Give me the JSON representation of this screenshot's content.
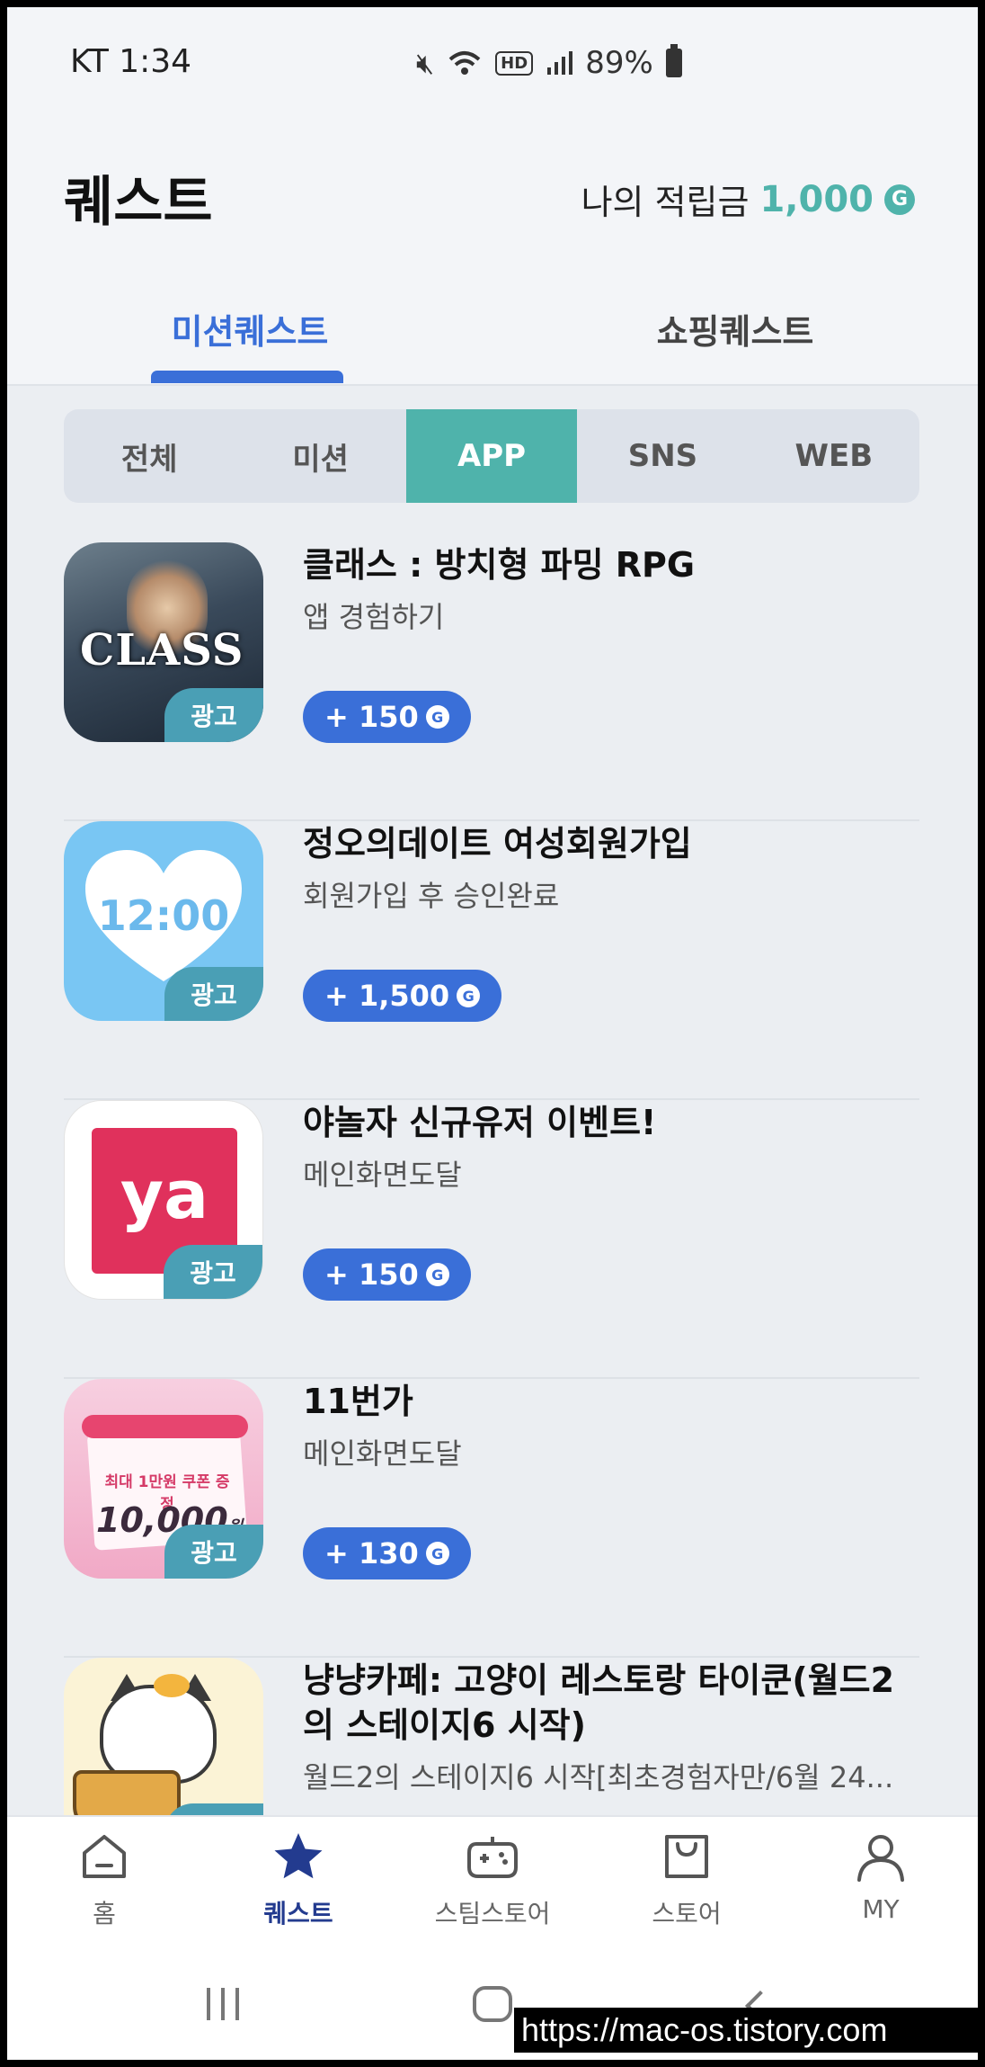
{
  "status": {
    "carrier_time": "KT 1:34",
    "battery": "89%",
    "hd": "HD"
  },
  "header": {
    "title": "퀘스트",
    "points_label": "나의 적립금",
    "points_value": "1,000",
    "coin_symbol": "G"
  },
  "tabs": [
    {
      "label": "미션퀘스트",
      "active": true
    },
    {
      "label": "쇼핑퀘스트",
      "active": false
    }
  ],
  "filter": {
    "chips": [
      {
        "label": "전체",
        "active": false
      },
      {
        "label": "미션",
        "active": false
      },
      {
        "label": "APP",
        "active": true
      },
      {
        "label": "SNS",
        "active": false
      },
      {
        "label": "WEB",
        "active": false
      }
    ]
  },
  "ad_badge": "광고",
  "quests": [
    {
      "title": "클래스 : 방치형 파밍 RPG",
      "desc": "앱 경험하기",
      "reward": "+ 150",
      "icon": "class-game-icon",
      "icon_text": "CLASS"
    },
    {
      "title": "정오의데이트 여성회원가입",
      "desc": "회원가입 후 승인완료",
      "reward": "+ 1,500",
      "icon": "date-app-icon",
      "icon_text": "12:00"
    },
    {
      "title": "야놀자 신규유저 이벤트!",
      "desc": "메인화면도달",
      "reward": "+ 150",
      "icon": "yanolja-icon",
      "icon_text": "ya"
    },
    {
      "title": "11번가",
      "desc": "메인화면도달",
      "reward": "+ 130",
      "icon": "11st-icon",
      "icon_text": "최대 1만원 쿠폰 증정",
      "icon_amount": "10,000",
      "icon_unit": "원"
    },
    {
      "title": "냥냥카페: 고양이 레스토랑 타이쿤(월드2의 스테이지6 시작)",
      "desc": "월드2의 스테이지6 시작[최초경험자만/6월 24...",
      "reward": "",
      "icon": "cat-cafe-icon"
    }
  ],
  "bottom_nav": [
    {
      "label": "홈",
      "icon": "home-icon",
      "active": false
    },
    {
      "label": "퀘스트",
      "icon": "star-icon",
      "active": true
    },
    {
      "label": "스팀스토어",
      "icon": "gamepad-icon",
      "active": false
    },
    {
      "label": "스토어",
      "icon": "shopping-bag-icon",
      "active": false
    },
    {
      "label": "MY",
      "icon": "person-icon",
      "active": false
    }
  ],
  "watermark": "https://mac-os.tistory.com",
  "colors": {
    "accent": "#3a6fd8",
    "teal": "#4fb3ab",
    "nav_active": "#233b8f"
  }
}
